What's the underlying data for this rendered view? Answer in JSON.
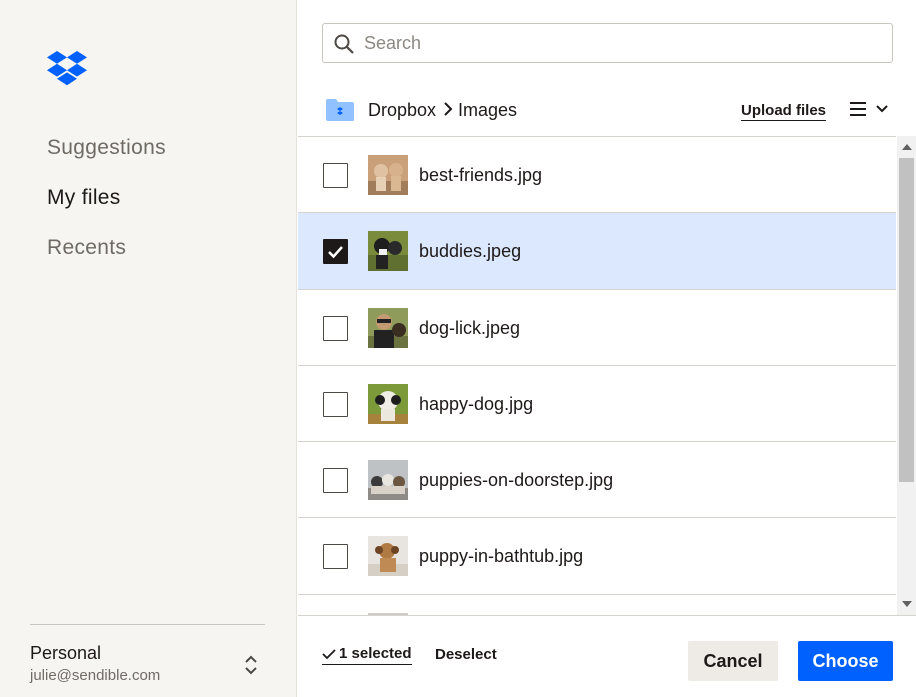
{
  "sidebar": {
    "nav": [
      {
        "label": "Suggestions"
      },
      {
        "label": "My files"
      },
      {
        "label": "Recents"
      }
    ],
    "account": {
      "name": "Personal",
      "email": "julie@sendible.com"
    }
  },
  "search": {
    "placeholder": "Search",
    "value": ""
  },
  "breadcrumb": {
    "root": "Dropbox",
    "current": "Images"
  },
  "toolbar": {
    "upload_label": "Upload files"
  },
  "files": [
    {
      "name": "best-friends.jpg",
      "selected": false
    },
    {
      "name": "buddies.jpeg",
      "selected": true
    },
    {
      "name": "dog-lick.jpeg",
      "selected": false
    },
    {
      "name": "happy-dog.jpg",
      "selected": false
    },
    {
      "name": "puppies-on-doorstep.jpg",
      "selected": false
    },
    {
      "name": "puppy-in-bathtub.jpg",
      "selected": false
    },
    {
      "name": "",
      "selected": false
    }
  ],
  "footer": {
    "selected_label": "1 selected",
    "deselect_label": "Deselect",
    "cancel_label": "Cancel",
    "choose_label": "Choose"
  },
  "colors": {
    "accent": "#0061fe",
    "selected_row": "#dbe8fd",
    "sidebar_bg": "#f7f5f2"
  }
}
